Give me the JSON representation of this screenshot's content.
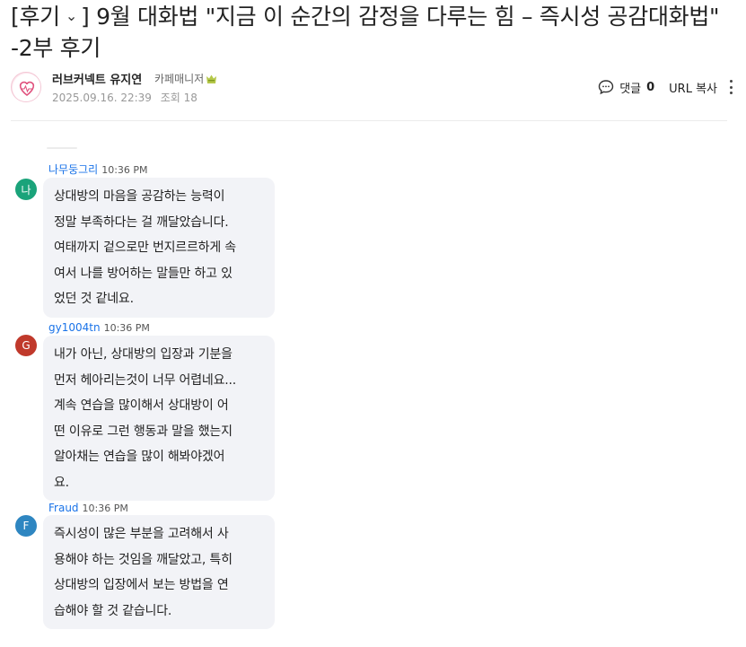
{
  "post": {
    "category": "[후기",
    "title_rest": "] 9월 대화법 \"지금 이 순간의 감정을 다루는 힘 – 즉시성 공감대화법\" -2부 후기",
    "author": "러브커넥트 유지연",
    "grade": "카페매니저",
    "date": "2025.09.16. 22:39",
    "views": "조회 18"
  },
  "actions": {
    "comment_label": "댓글",
    "comment_count": "0",
    "url_copy": "URL 복사"
  },
  "comments": [
    {
      "initial": "나",
      "author": "나무둥그리",
      "time": "10:36 PM",
      "avatar_color": "#1aa37a",
      "lines": [
        "상대방의 마음을 공감하는 능력이",
        "정말 부족하다는 걸 깨달았습니다.",
        "여태까지 겉으로만 번지르르하게 속",
        "여서 나를 방어하는 말들만 하고 있",
        "었던 것 같네요."
      ]
    },
    {
      "initial": "G",
      "author": "gy1004tn",
      "time": "10:36 PM",
      "avatar_color": "#c0392b",
      "lines": [
        "내가 아닌, 상대방의 입장과 기분을",
        "먼저 헤아리는것이 너무 어렵네요...",
        "계속 연습을 많이해서 상대방이 어",
        "떤 이유로 그런 행동과 말을 했는지",
        "알아채는 연습을 많이 해봐야겠어",
        "요."
      ]
    },
    {
      "initial": "F",
      "author": "Fraud",
      "time": "10:36 PM",
      "avatar_color": "#2e86c1",
      "lines": [
        "즉시성이 많은 부분을 고려해서 사",
        "용해야 하는 것임을 깨달았고, 특히",
        "상대방의 입장에서 보는 방법을 연",
        "습해야 할 것 같습니다."
      ]
    }
  ]
}
